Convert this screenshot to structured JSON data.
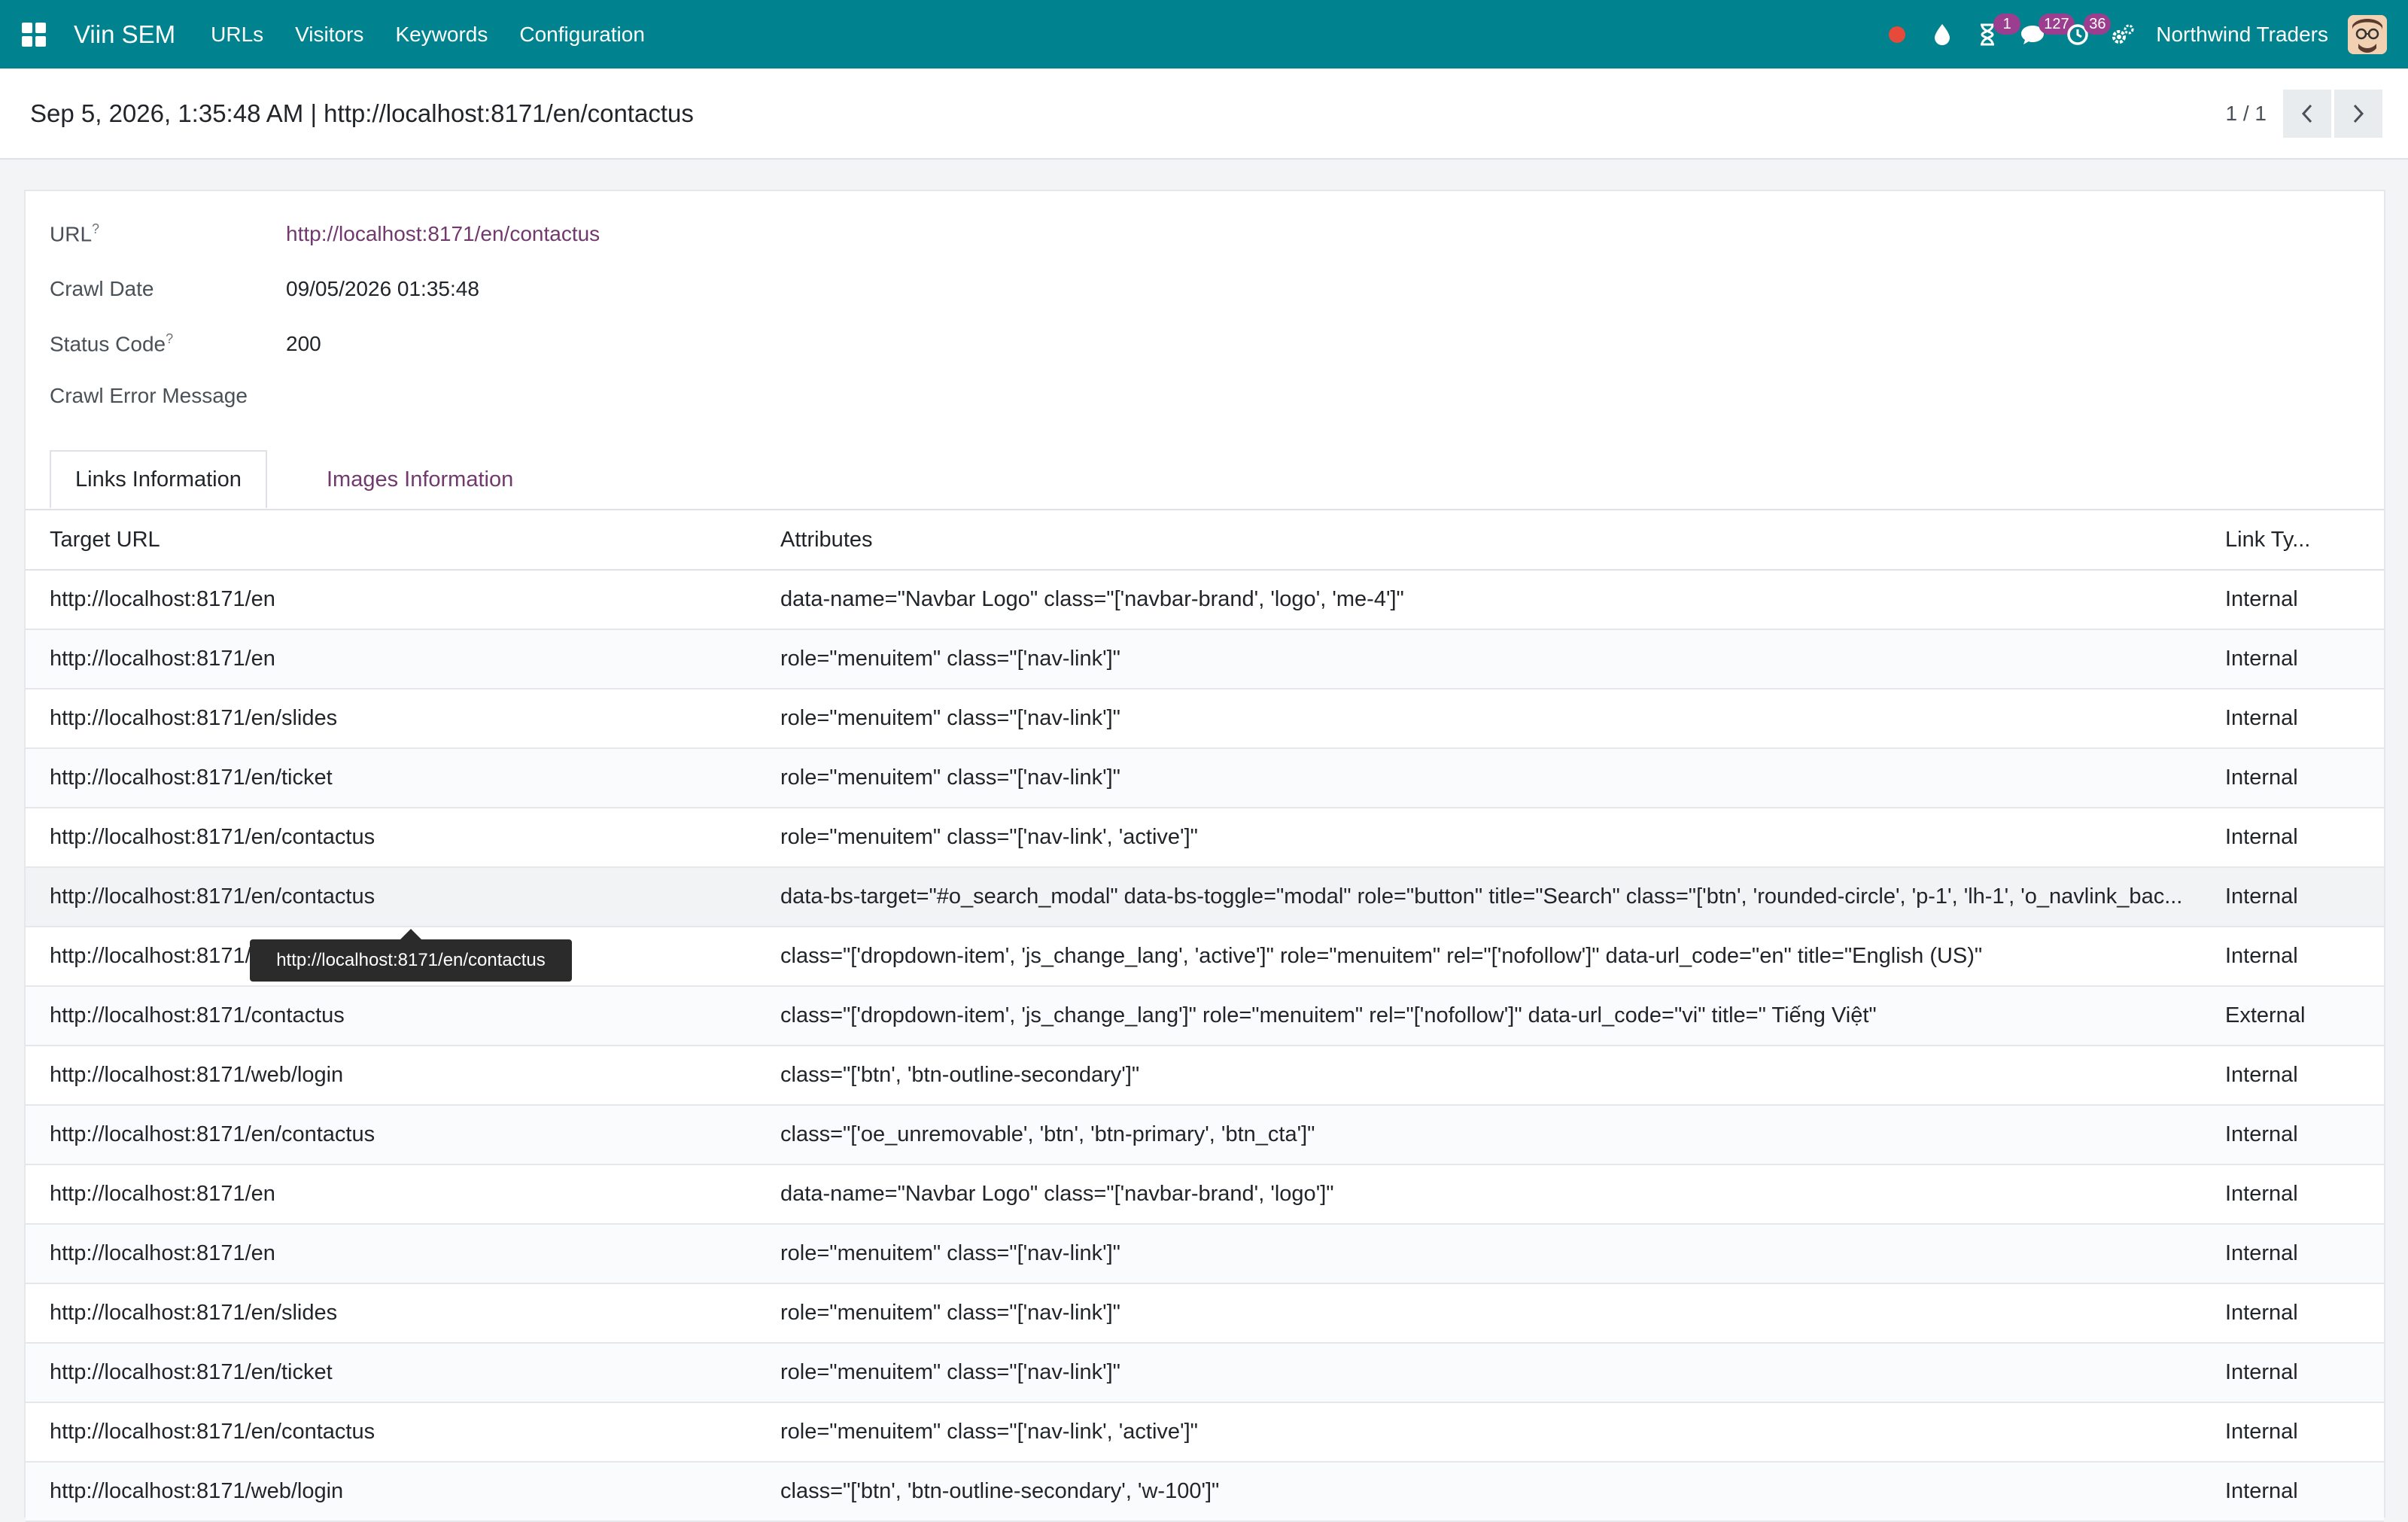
{
  "navbar": {
    "brand": "Viin SEM",
    "menu": [
      "URLs",
      "Visitors",
      "Keywords",
      "Configuration"
    ],
    "badges": {
      "activity": "1",
      "messages": "127",
      "clock": "36"
    },
    "company": "Northwind Traders"
  },
  "control_panel": {
    "breadcrumb": "Sep 5, 2026, 1:35:48 AM | http://localhost:8171/en/contactus",
    "pager": "1 / 1"
  },
  "form": {
    "url_label": "URL",
    "url_help": "?",
    "url_value": "http://localhost:8171/en/contactus",
    "crawl_date_label": "Crawl Date",
    "crawl_date_value": "09/05/2026 01:35:48",
    "status_code_label": "Status Code",
    "status_code_help": "?",
    "status_code_value": "200",
    "crawl_error_label": "Crawl Error Message",
    "crawl_error_value": ""
  },
  "tabs": {
    "links": "Links Information",
    "images": "Images Information"
  },
  "table": {
    "headers": {
      "target_url": "Target URL",
      "attributes": "Attributes",
      "link_type": "Link Ty..."
    },
    "rows": [
      {
        "url": "http://localhost:8171/en",
        "attr": "data-name=\"Navbar Logo\" class=\"['navbar-brand', 'logo', 'me-4']\"",
        "type": "Internal"
      },
      {
        "url": "http://localhost:8171/en",
        "attr": "role=\"menuitem\" class=\"['nav-link']\"",
        "type": "Internal"
      },
      {
        "url": "http://localhost:8171/en/slides",
        "attr": "role=\"menuitem\" class=\"['nav-link']\"",
        "type": "Internal"
      },
      {
        "url": "http://localhost:8171/en/ticket",
        "attr": "role=\"menuitem\" class=\"['nav-link']\"",
        "type": "Internal"
      },
      {
        "url": "http://localhost:8171/en/contactus",
        "attr": "role=\"menuitem\" class=\"['nav-link', 'active']\"",
        "type": "Internal"
      },
      {
        "url": "http://localhost:8171/en/contactus",
        "attr": "data-bs-target=\"#o_search_modal\" data-bs-toggle=\"modal\" role=\"button\" title=\"Search\" class=\"['btn', 'rounded-circle', 'p-1', 'lh-1', 'o_navlink_bac...",
        "type": "Internal"
      },
      {
        "url": "http://localhost:8171/en/contactus",
        "attr": "class=\"['dropdown-item', 'js_change_lang', 'active']\" role=\"menuitem\" rel=\"['nofollow']\" data-url_code=\"en\" title=\"English (US)\"",
        "type": "Internal"
      },
      {
        "url": "http://localhost:8171/contactus",
        "attr": "class=\"['dropdown-item', 'js_change_lang']\" role=\"menuitem\" rel=\"['nofollow']\" data-url_code=\"vi\" title=\" Tiếng Việt\"",
        "type": "External"
      },
      {
        "url": "http://localhost:8171/web/login",
        "attr": "class=\"['btn', 'btn-outline-secondary']\"",
        "type": "Internal"
      },
      {
        "url": "http://localhost:8171/en/contactus",
        "attr": "class=\"['oe_unremovable', 'btn', 'btn-primary', 'btn_cta']\"",
        "type": "Internal"
      },
      {
        "url": "http://localhost:8171/en",
        "attr": "data-name=\"Navbar Logo\" class=\"['navbar-brand', 'logo']\"",
        "type": "Internal"
      },
      {
        "url": "http://localhost:8171/en",
        "attr": "role=\"menuitem\" class=\"['nav-link']\"",
        "type": "Internal"
      },
      {
        "url": "http://localhost:8171/en/slides",
        "attr": "role=\"menuitem\" class=\"['nav-link']\"",
        "type": "Internal"
      },
      {
        "url": "http://localhost:8171/en/ticket",
        "attr": "role=\"menuitem\" class=\"['nav-link']\"",
        "type": "Internal"
      },
      {
        "url": "http://localhost:8171/en/contactus",
        "attr": "role=\"menuitem\" class=\"['nav-link', 'active']\"",
        "type": "Internal"
      },
      {
        "url": "http://localhost:8171/web/login",
        "attr": "class=\"['btn', 'btn-outline-secondary', 'w-100']\"",
        "type": "Internal"
      }
    ]
  },
  "tooltip": "http://localhost:8171/en/contactus"
}
